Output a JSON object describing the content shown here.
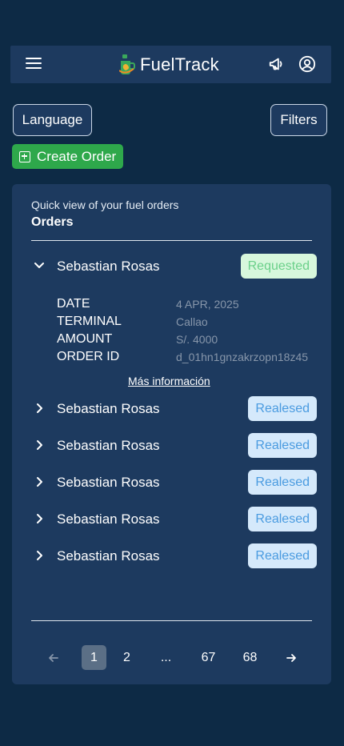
{
  "app": {
    "title": "FuelTrack"
  },
  "toolbar": {
    "language_label": "Language",
    "filters_label": "Filters",
    "create_order_label": "Create Order"
  },
  "orders_card": {
    "subtitle": "Quick view of your fuel orders",
    "title": "Orders",
    "expanded": {
      "name": "Sebastian Rosas",
      "status": "Requested",
      "details": [
        {
          "label": "DATE",
          "value": "4 APR, 2025"
        },
        {
          "label": "TERMINAL",
          "value": "Callao"
        },
        {
          "label": "AMOUNT",
          "value": "S/. 4000"
        },
        {
          "label": "ORDER ID",
          "value": "d_01hn1gnzakrzopn18z45"
        }
      ],
      "more_link": "Más información"
    },
    "rows": [
      {
        "name": "Sebastian Rosas",
        "status": "Realesed"
      },
      {
        "name": "Sebastian Rosas",
        "status": "Realesed"
      },
      {
        "name": "Sebastian Rosas",
        "status": "Realesed"
      },
      {
        "name": "Sebastian Rosas",
        "status": "Realesed"
      },
      {
        "name": "Sebastian Rosas",
        "status": "Realesed"
      }
    ]
  },
  "pagination": {
    "pages": [
      "1",
      "2",
      "...",
      "67",
      "68"
    ],
    "current": "1"
  },
  "icons": {
    "menu": "hamburger-icon",
    "logo": "fuel-cup-logo-icon",
    "announcements": "megaphone-icon",
    "account": "user-circle-icon",
    "create": "plus-square-icon",
    "expand": "chevron-icon",
    "prev": "arrow-left-icon",
    "next": "arrow-right-icon"
  },
  "colors": {
    "background": "#0d2a45",
    "surface": "#1d3a5f",
    "primary_green": "#2ea84b",
    "requested_bg": "#d7f7dc",
    "requested_text": "#6bd08a",
    "released_bg": "#d5e9fb",
    "released_text": "#4a9be0"
  }
}
